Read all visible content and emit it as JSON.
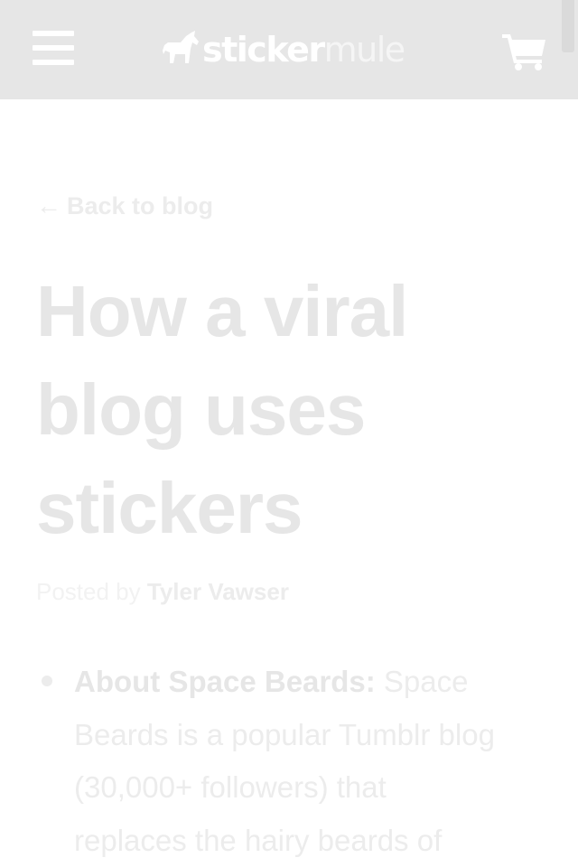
{
  "header": {
    "logo_part1": "sticker",
    "logo_part2": "mule",
    "menu_icon": "hamburger-menu-icon",
    "cart_icon": "shopping-cart-icon"
  },
  "article": {
    "back_arrow": "←",
    "back_label": "Back to blog",
    "title_lines": [
      "How a viral",
      "blog uses",
      "stickers"
    ],
    "byline_prefix": "Posted by",
    "author": "Tyler Vawser",
    "bullets": [
      {
        "lead": "About Space Beards:",
        "lines": [
          " Space",
          "Beards is a popular Tumblr blog",
          "(30,000+ followers) that",
          "replaces the hairy beards of"
        ]
      }
    ]
  },
  "colors": {
    "header_bg": "#e6e6e6",
    "text": "#e6e6e6",
    "page_bg": "#ffffff"
  }
}
